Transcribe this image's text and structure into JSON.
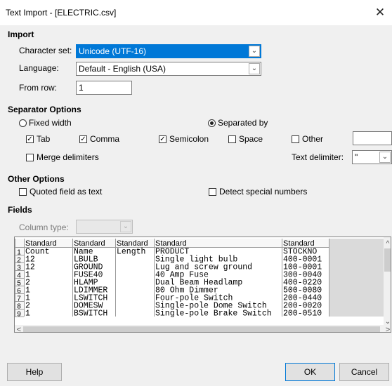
{
  "window": {
    "title": "Text Import - [ELECTRIC.csv]",
    "close_glyph": "✕"
  },
  "import": {
    "heading": "Import",
    "charset_label": "Character set:",
    "charset_value": "Unicode (UTF-16)",
    "language_label": "Language:",
    "language_value": "Default - English (USA)",
    "from_row_label": "From row:",
    "from_row_value": "1"
  },
  "separator": {
    "heading": "Separator Options",
    "fixed_width": {
      "label": "Fixed width",
      "selected": false
    },
    "separated_by": {
      "label": "Separated by",
      "selected": true
    },
    "tab": {
      "label": "Tab",
      "checked": true
    },
    "comma": {
      "label": "Comma",
      "checked": true
    },
    "semicolon": {
      "label": "Semicolon",
      "checked": true
    },
    "space": {
      "label": "Space",
      "checked": false
    },
    "other": {
      "label": "Other",
      "checked": false,
      "value": ""
    },
    "merge": {
      "label": "Merge delimiters",
      "checked": false
    },
    "text_delimiter_label": "Text delimiter:",
    "text_delimiter_value": "\""
  },
  "other_options": {
    "heading": "Other Options",
    "quoted": {
      "label": "Quoted field as text",
      "checked": false
    },
    "special": {
      "label": "Detect special numbers",
      "checked": false
    }
  },
  "fields": {
    "heading": "Fields",
    "column_type_label": "Column type:",
    "column_type_value": "",
    "header_cells": [
      "Standard",
      "Standard",
      "Standard",
      "Standard",
      "Standard"
    ],
    "rows": [
      {
        "n": "1",
        "cells": [
          "Count",
          "Name",
          "Length",
          "PRODUCT",
          "STOCKNO"
        ]
      },
      {
        "n": "2",
        "cells": [
          "12",
          "LBULB",
          "",
          "Single light bulb",
          "400-0001"
        ]
      },
      {
        "n": "3",
        "cells": [
          "12",
          "GROUND",
          "",
          "Lug and screw ground",
          "100-0001"
        ]
      },
      {
        "n": "4",
        "cells": [
          "1",
          "FUSE40",
          "",
          "40 Amp Fuse",
          "300-0040"
        ]
      },
      {
        "n": "5",
        "cells": [
          "2",
          "HLAMP",
          "",
          "Dual Beam Headlamp",
          "400-0220"
        ]
      },
      {
        "n": "6",
        "cells": [
          "1",
          "LDIMMER",
          "",
          "80 Ohm Dimmer",
          "500-0080"
        ]
      },
      {
        "n": "7",
        "cells": [
          "1",
          "LSWITCH",
          "",
          "Four-pole Switch",
          "200-0440"
        ]
      },
      {
        "n": "8",
        "cells": [
          "2",
          "DOMESW",
          "",
          "Single-pole Dome Switch",
          "200-0020"
        ]
      },
      {
        "n": "9",
        "cells": [
          "1",
          "BSWITCH",
          "",
          "Single-pole Brake Switch",
          "200-0510"
        ]
      }
    ]
  },
  "buttons": {
    "help": "Help",
    "ok": "OK",
    "cancel": "Cancel"
  },
  "glyphs": {
    "check": "✓",
    "chevron_down": "⌄",
    "up": "^",
    "down": "⌄",
    "left": "<",
    "right": ">"
  }
}
